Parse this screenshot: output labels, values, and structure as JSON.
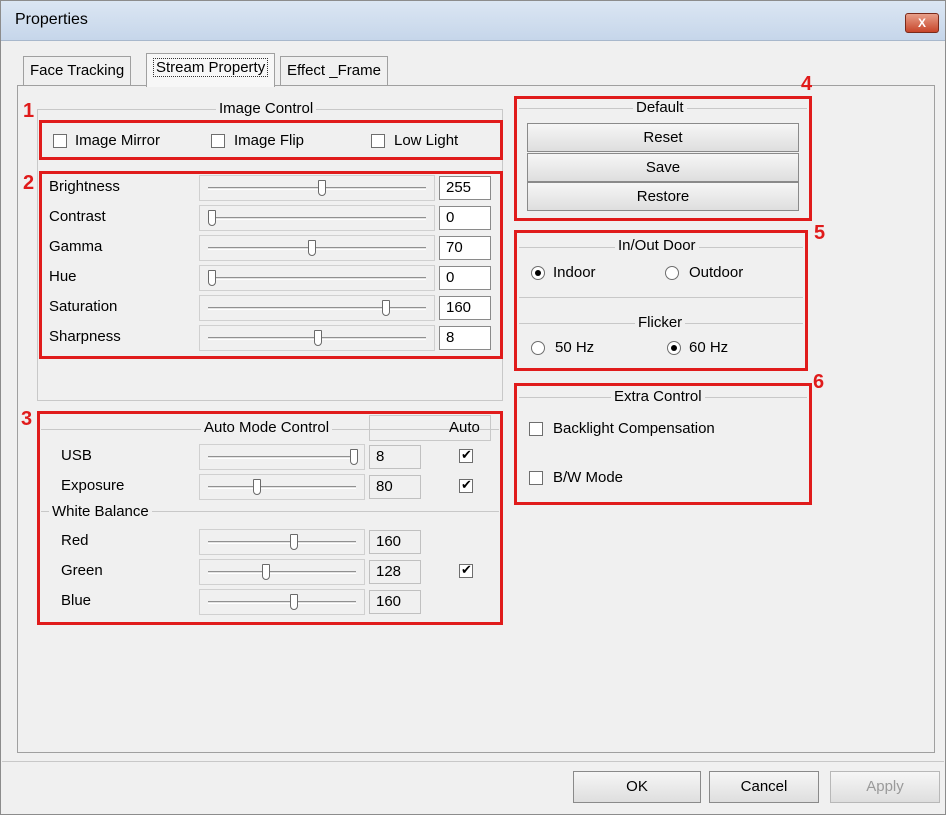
{
  "window": {
    "title": "Properties",
    "close_symbol": "X"
  },
  "tabs": [
    {
      "label": "Face Tracking",
      "active": false
    },
    {
      "label": "Stream Property",
      "active": true
    },
    {
      "label": "Effect _Frame",
      "active": false
    }
  ],
  "annotations": [
    "1",
    "2",
    "3",
    "4",
    "5",
    "6"
  ],
  "accent_color": "#e01b1b",
  "image_control": {
    "title": "Image Control",
    "checkboxes": [
      {
        "label": "Image Mirror",
        "checked": false
      },
      {
        "label": "Image Flip",
        "checked": false
      },
      {
        "label": "Low Light",
        "checked": false
      }
    ],
    "sliders": [
      {
        "label": "Brightness",
        "value": "255",
        "level": 0.52
      },
      {
        "label": "Contrast",
        "value": "0",
        "level": 0.0
      },
      {
        "label": "Gamma",
        "value": "70",
        "level": 0.47
      },
      {
        "label": "Hue",
        "value": "0",
        "level": 0.0
      },
      {
        "label": "Saturation",
        "value": "160",
        "level": 0.82
      },
      {
        "label": "Sharpness",
        "value": "8",
        "level": 0.5
      }
    ]
  },
  "auto_mode": {
    "title": "Auto Mode Control",
    "auto_header": "Auto",
    "rows": [
      {
        "label": "USB",
        "value": "8",
        "level": 1.0,
        "auto": true
      },
      {
        "label": "Exposure",
        "value": "80",
        "level": 0.32,
        "auto": true
      }
    ],
    "white_balance_title": "White Balance",
    "wb_rows": [
      {
        "label": "Red",
        "value": "160",
        "level": 0.58
      },
      {
        "label": "Green",
        "value": "128",
        "level": 0.38,
        "auto": true
      },
      {
        "label": "Blue",
        "value": "160",
        "level": 0.58
      }
    ]
  },
  "default": {
    "title": "Default",
    "buttons": [
      "Reset",
      "Save",
      "Restore"
    ]
  },
  "in_out_door": {
    "title": "In/Out Door",
    "options": [
      {
        "label": "Indoor",
        "selected": true
      },
      {
        "label": "Outdoor",
        "selected": false
      }
    ]
  },
  "flicker": {
    "title": "Flicker",
    "options": [
      {
        "label": "50 Hz",
        "selected": false
      },
      {
        "label": "60 Hz",
        "selected": true
      }
    ]
  },
  "extra_control": {
    "title": "Extra Control",
    "checkboxes": [
      {
        "label": "Backlight Compensation",
        "checked": false
      },
      {
        "label": "B/W Mode",
        "checked": false
      }
    ]
  },
  "footer": {
    "ok": "OK",
    "cancel": "Cancel",
    "apply": "Apply"
  }
}
